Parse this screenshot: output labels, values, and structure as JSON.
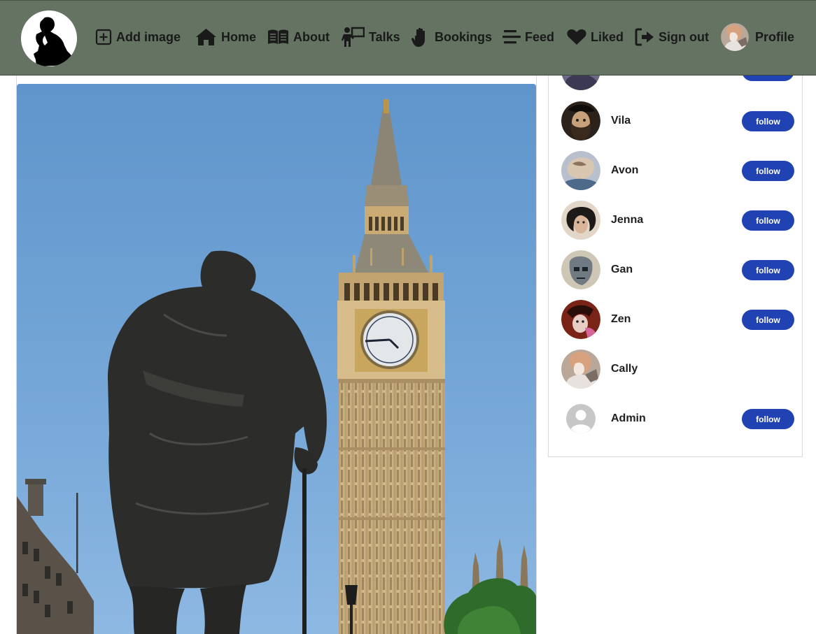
{
  "navbar": {
    "logo": "thinker-silhouette-logo",
    "items": [
      {
        "label": "Add image",
        "icon": "plus-square-icon"
      },
      {
        "label": "Home",
        "icon": "home-icon"
      },
      {
        "label": "About",
        "icon": "open-book-icon"
      },
      {
        "label": "Talks",
        "icon": "presenter-icon"
      },
      {
        "label": "Bookings",
        "icon": "hand-icon"
      },
      {
        "label": "Feed",
        "icon": "stream-lines-icon"
      },
      {
        "label": "Liked",
        "icon": "heart-icon"
      },
      {
        "label": "Sign out",
        "icon": "sign-out-icon"
      },
      {
        "label": "Profile",
        "icon": "profile-avatar"
      }
    ],
    "colors": {
      "background": "#647362",
      "text": "#1a1a1a"
    }
  },
  "post": {
    "image_description_icon": "big-ben-photo"
  },
  "profiles": {
    "follow_label": "follow",
    "accent": "#2142b3",
    "items": [
      {
        "name": "",
        "has_follow": true
      },
      {
        "name": "Vila",
        "has_follow": true
      },
      {
        "name": "Avon",
        "has_follow": true
      },
      {
        "name": "Jenna",
        "has_follow": true
      },
      {
        "name": "Gan",
        "has_follow": true
      },
      {
        "name": "Zen",
        "has_follow": true
      },
      {
        "name": "Cally",
        "has_follow": false
      },
      {
        "name": "Admin",
        "has_follow": true
      }
    ]
  }
}
